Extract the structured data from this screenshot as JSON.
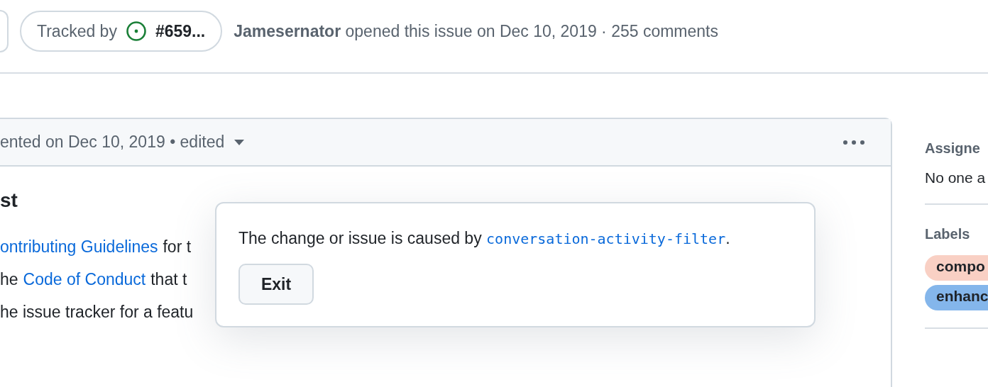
{
  "header": {
    "tracked_by": {
      "label": "Tracked by",
      "issue": "#659..."
    },
    "author": "Jamesernator",
    "opened_text": "opened this issue on Dec 10, 2019 · 255 comments"
  },
  "comment": {
    "meta": "ented on Dec 10, 2019 • edited",
    "heading": "st",
    "lines": [
      [
        {
          "kind": "link",
          "text": "ontributing Guidelines"
        },
        {
          "kind": "text",
          "text": "for t"
        }
      ],
      [
        {
          "kind": "text",
          "text": "he"
        },
        {
          "kind": "link",
          "text": "Code of Conduct"
        },
        {
          "kind": "text",
          "text": "that t"
        }
      ],
      [
        {
          "kind": "text",
          "text": "he issue tracker for a featu"
        }
      ]
    ]
  },
  "popup": {
    "message": "The change or issue is caused by",
    "code": "conversation-activity-filter",
    "end": ".",
    "button": "Exit"
  },
  "sidebar": [
    {
      "title": "Assigne",
      "value": "No one a"
    },
    {
      "title": "Labels",
      "labels": [
        {
          "name": "compo",
          "color": "#f9d0c4"
        },
        {
          "name": "enhanc",
          "color": "#84b6eb"
        }
      ]
    }
  ]
}
